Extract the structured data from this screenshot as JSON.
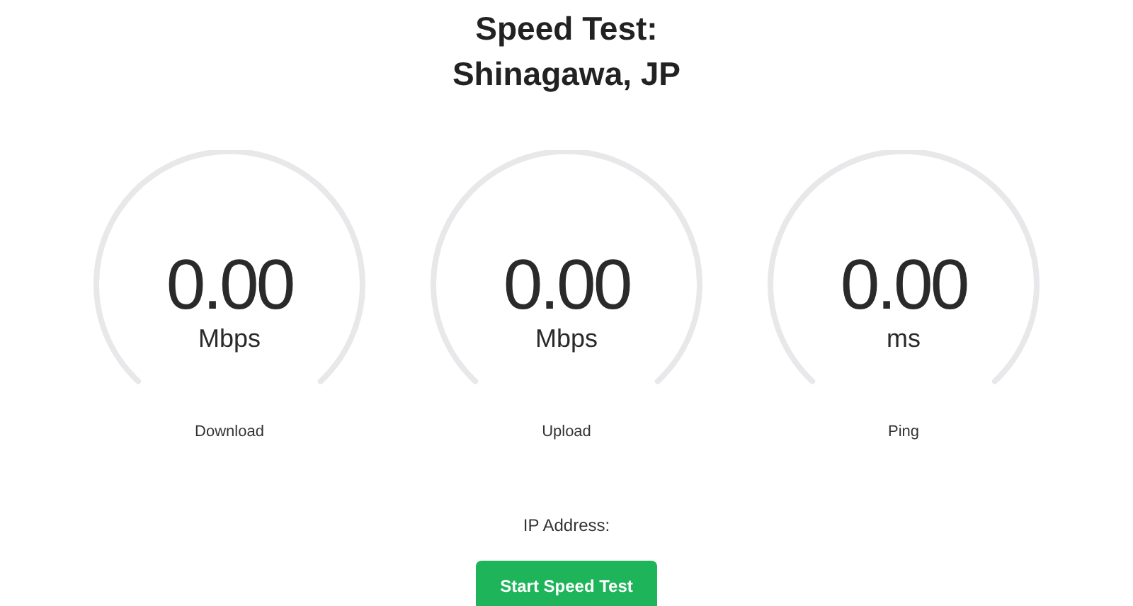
{
  "title": [
    "Speed Test:",
    "Shinagawa, JP"
  ],
  "gauges": [
    {
      "value": "0.00",
      "unit": "Mbps",
      "label": "Download"
    },
    {
      "value": "0.00",
      "unit": "Mbps",
      "label": "Upload"
    },
    {
      "value": "0.00",
      "unit": "ms",
      "label": "Ping"
    }
  ],
  "ip_address_label": "IP Address:",
  "start_button": "Start Speed Test"
}
